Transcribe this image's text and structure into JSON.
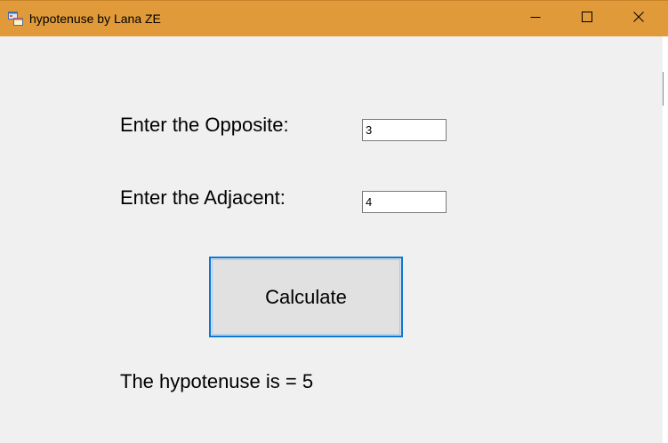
{
  "window": {
    "title": "hypotenuse by Lana ZE",
    "titlebar_color": "#e09a3a",
    "controls": {
      "minimize": "minimize-icon",
      "maximize": "maximize-icon",
      "close": "close-icon"
    }
  },
  "form": {
    "opposite_label": "Enter the Opposite:",
    "opposite_value": "3",
    "adjacent_label": "Enter the Adjacent:",
    "adjacent_value": "4",
    "calculate_label": "Calculate",
    "calculate_border_color": "#0a78d7",
    "result_text": "The hypotenuse is = 5"
  }
}
